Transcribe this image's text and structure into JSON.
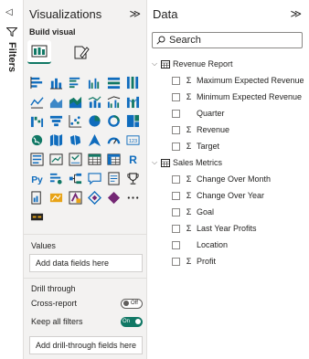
{
  "filters": {
    "label": "Filters",
    "collapse_glyph": "◁"
  },
  "visualizations": {
    "title": "Visualizations",
    "expand_glyph": "≫",
    "build_visual_label": "Build visual",
    "gallery": [
      [
        "stacked-bar-chart",
        "stacked-column-chart",
        "clustered-bar-chart",
        "clustered-column-chart",
        "100-stacked-bar-chart",
        "100-stacked-column-chart"
      ],
      [
        "line-chart",
        "area-chart",
        "stacked-area-chart",
        "line-stacked-column-chart",
        "line-clustered-column-chart",
        "ribbon-chart"
      ],
      [
        "waterfall-chart",
        "funnel-chart",
        "scatter-chart",
        "pie-chart",
        "donut-chart",
        "treemap"
      ],
      [
        "map",
        "filled-map",
        "shape-map",
        "azure-map",
        "gauge",
        "card"
      ],
      [
        "multi-row-card",
        "kpi",
        "slicer",
        "table",
        "matrix",
        "r-visual"
      ],
      [
        "python-visual",
        "key-influencers",
        "decomposition-tree",
        "qa-visual",
        "smart-narrative",
        "trophy-visual"
      ],
      [
        "paginated-report",
        "arcgis-map",
        "power-apps",
        "power-automate",
        "diamond-visual",
        "more-visuals"
      ],
      [
        "custom-visual"
      ]
    ],
    "values_label": "Values",
    "values_placeholder": "Add data fields here",
    "drill_through_label": "Drill through",
    "cross_report_label": "Cross-report",
    "cross_report_state": "Off",
    "keep_all_filters_label": "Keep all filters",
    "keep_all_filters_state": "On",
    "drill_placeholder": "Add drill-through fields here"
  },
  "data": {
    "title": "Data",
    "expand_glyph": "≫",
    "search_placeholder": "Search",
    "tables": [
      {
        "name": "Revenue Report",
        "fields": [
          {
            "name": "Maximum Expected Revenue",
            "sigma": true
          },
          {
            "name": "Minimum Expected Revenue",
            "sigma": true
          },
          {
            "name": "Quarter",
            "sigma": false
          },
          {
            "name": "Revenue",
            "sigma": true
          },
          {
            "name": "Target",
            "sigma": true
          }
        ]
      },
      {
        "name": "Sales Metrics",
        "fields": [
          {
            "name": "Change Over Month",
            "sigma": true
          },
          {
            "name": "Change Over Year",
            "sigma": true
          },
          {
            "name": "Goal",
            "sigma": true
          },
          {
            "name": "Last Year Profits",
            "sigma": true
          },
          {
            "name": "Location",
            "sigma": false
          },
          {
            "name": "Profit",
            "sigma": true
          }
        ]
      }
    ]
  },
  "colors": {
    "accent": "#117865",
    "icon_blue": "#0f6cbd",
    "icon_teal": "#117865",
    "icon_yellow": "#e8a317"
  }
}
